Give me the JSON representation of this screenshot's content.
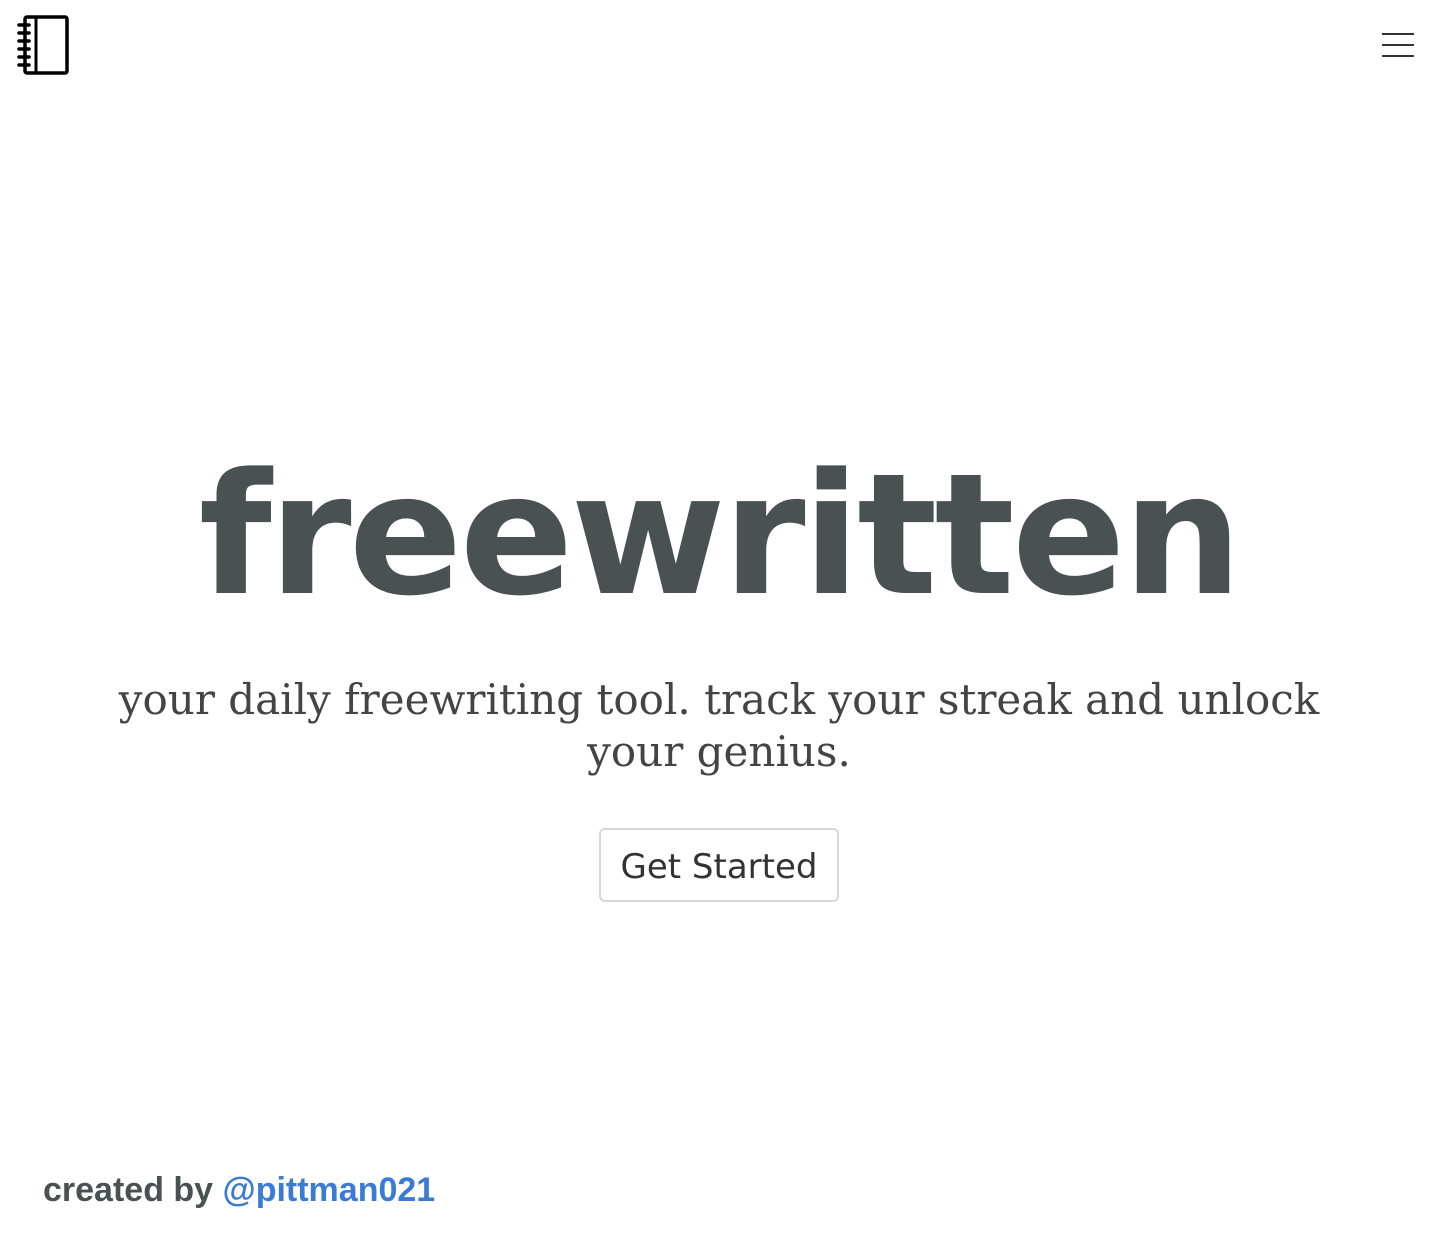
{
  "header": {
    "logo_icon": "notebook-icon",
    "menu_icon": "hamburger-menu-icon"
  },
  "hero": {
    "title": "freewritten",
    "tagline": "your daily freewriting tool. track your streak and unlock your genius.",
    "cta_label": "Get Started"
  },
  "footer": {
    "prefix": "created by",
    "author_link": "@pittman021"
  },
  "colors": {
    "title": "#4a5152",
    "text": "#444444",
    "link": "#3a7bd5",
    "button_border": "#d8d8d8",
    "background": "#ffffff"
  }
}
